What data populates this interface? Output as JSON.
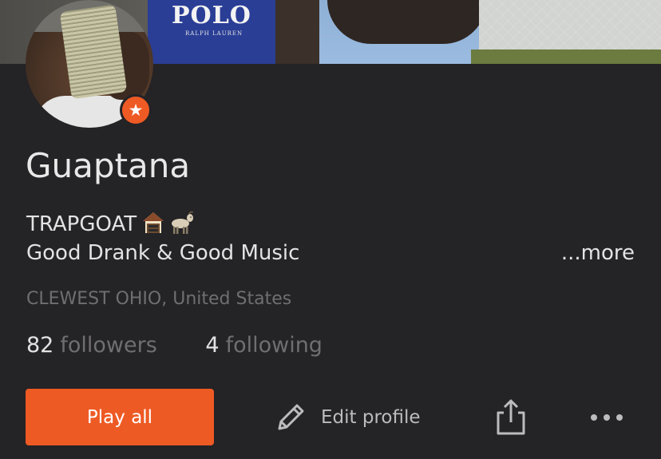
{
  "profile": {
    "username": "Guaptana",
    "bio_line1": "TRAPGOAT",
    "bio_line2": "Good Drank & Good Music",
    "bio_emojis": [
      "house-icon",
      "goat-icon"
    ],
    "more_label": "...more",
    "location": "CLEWEST OHIO, United States",
    "pro_badge_icon": "star-icon"
  },
  "stats": {
    "followers_count": "82",
    "followers_label": "followers",
    "following_count": "4",
    "following_label": "following"
  },
  "actions": {
    "play_all_label": "Play all",
    "edit_profile_label": "Edit profile",
    "share_icon": "share-icon",
    "more_icon": "more-options-icon"
  },
  "banner": {
    "shirt_text": "POLO",
    "shirt_subtext": "RALPH LAUREN"
  },
  "colors": {
    "background": "#242326",
    "accent": "#ee5a24",
    "primary_text": "#e3e3e3",
    "secondary_text": "#6f6e71"
  }
}
